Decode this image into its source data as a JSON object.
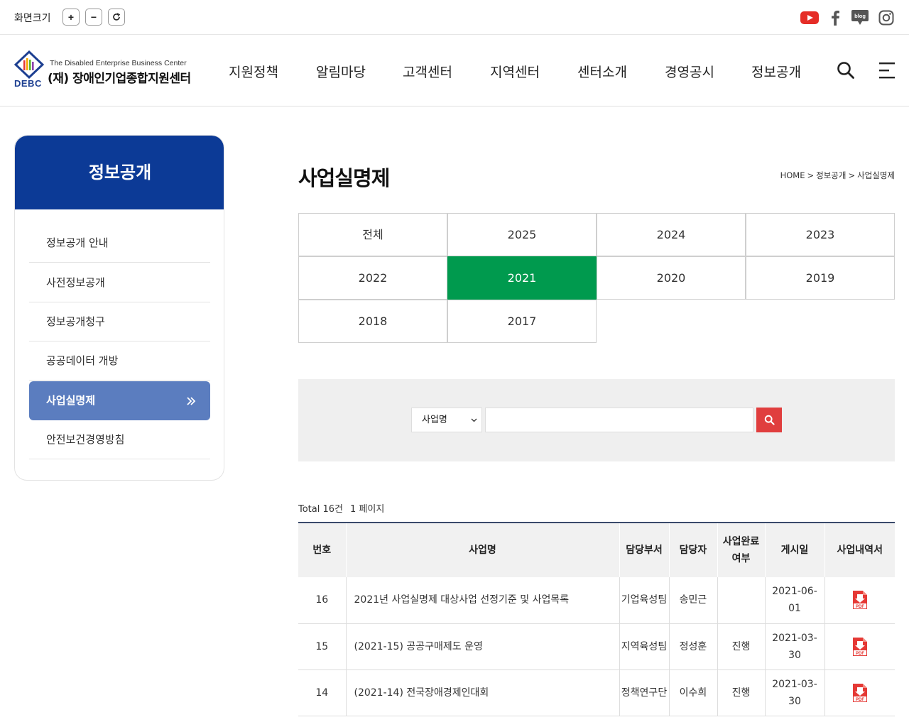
{
  "topbar": {
    "font_size_label": "화면크기",
    "zoom_in": "+",
    "zoom_out": "−",
    "reset": "↻",
    "social_icons": [
      "youtube-icon",
      "facebook-icon",
      "blog-icon",
      "instagram-icon"
    ],
    "blog_text": "blog"
  },
  "logo": {
    "subtitle": "The Disabled Enterprise Business Center",
    "title": "(재) 장애인기업종합지원센터",
    "abbr": "DEBC"
  },
  "nav": [
    "지원정책",
    "알림마당",
    "고객센터",
    "지역센터",
    "센터소개",
    "경영공시",
    "정보공개"
  ],
  "sidebar": {
    "title": "정보공개",
    "items": [
      "정보공개 안내",
      "사전정보공개",
      "정보공개청구",
      "공공데이터 개방",
      "사업실명제",
      "안전보건경영방침"
    ],
    "active_index": 4
  },
  "page": {
    "title": "사업실명제",
    "breadcrumb": [
      "HOME",
      "정보공개",
      "사업실명제"
    ],
    "breadcrumb_sep": ">"
  },
  "years": {
    "items": [
      "전체",
      "2025",
      "2024",
      "2023",
      "2022",
      "2021",
      "2020",
      "2019",
      "2018",
      "2017"
    ],
    "active": "2021"
  },
  "search": {
    "select_value": "사업명",
    "input_value": ""
  },
  "list_info": {
    "total": "Total 16건",
    "page": "1 페이지"
  },
  "table": {
    "headers": [
      "번호",
      "사업명",
      "담당부서",
      "담당자",
      "사업완료\n여부",
      "게시일",
      "사업내역서"
    ],
    "rows": [
      {
        "no": "16",
        "name": "2021년 사업실명제 대상사업 선정기준 및 사업목록",
        "dept": "기업육성팀",
        "person": "송민근",
        "status": "",
        "date": "2021-06-01",
        "file": "PDF"
      },
      {
        "no": "15",
        "name": "(2021-15) 공공구매제도 운영",
        "dept": "지역육성팀",
        "person": "정성훈",
        "status": "진행",
        "date": "2021-03-30",
        "file": "PDF"
      },
      {
        "no": "14",
        "name": "(2021-14) 전국장애경제인대회",
        "dept": "정책연구단",
        "person": "이수희",
        "status": "진행",
        "date": "2021-03-30",
        "file": "PDF"
      }
    ]
  },
  "colors": {
    "sidebar_head": "#0c3a96",
    "sidebar_active": "#5b7dbf",
    "year_active": "#009a4e",
    "search_button": "#e03e3e",
    "pdf_icon": "#e53935"
  }
}
